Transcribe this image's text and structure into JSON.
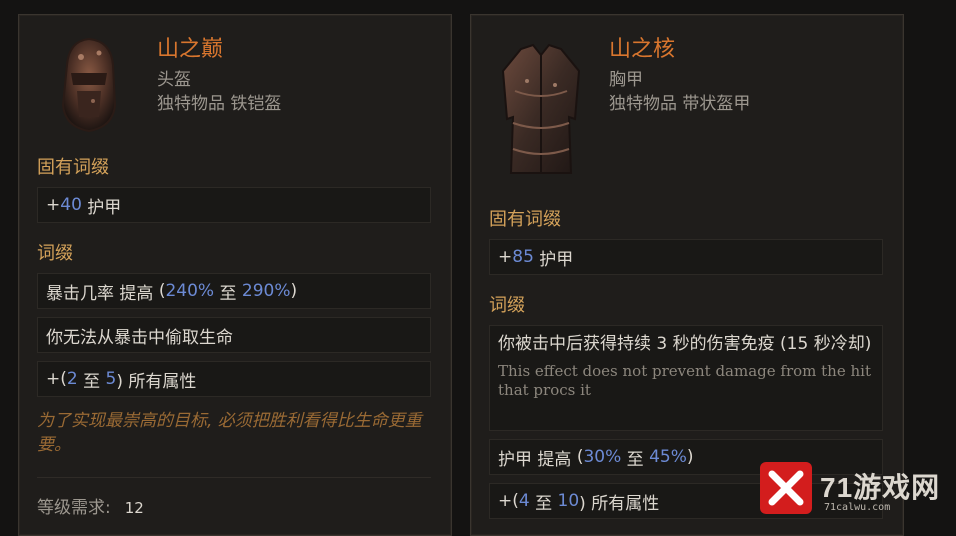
{
  "left_item": {
    "name": "山之巅",
    "type": "头盔",
    "rarity_line": "独特物品 铁铠盔",
    "implicit_header": "固有词缀",
    "implicit": {
      "prefix": "+",
      "value": "40",
      "label": "护甲"
    },
    "affix_header": "词缀",
    "affixes": [
      {
        "text": "暴击几率 提高",
        "open": "(",
        "min": "240%",
        "sep": "至",
        "max": "290%",
        "close": ")"
      },
      {
        "text": "你无法从暴击中偷取生命"
      },
      {
        "prefix": "+(",
        "min": "2",
        "sep": "至",
        "max": "5",
        "suffix": ") 所有属性"
      }
    ],
    "flavor": "为了实现最崇高的目标, 必须把胜利看得比生命更重要。",
    "level_label": "等级需求:",
    "level_value": "12"
  },
  "right_item": {
    "name": "山之核",
    "type": "胸甲",
    "rarity_line": "独特物品 带状盔甲",
    "implicit_header": "固有词缀",
    "implicit": {
      "prefix": "+",
      "value": "85",
      "label": "护甲"
    },
    "affix_header": "词缀",
    "affixes": [
      {
        "text": "你被击中后获得持续 3 秒的伤害免疫 (15 秒冷却)",
        "note": "This effect does not prevent damage from the hit that procs it"
      },
      {
        "text": "护甲 提高",
        "open": "(",
        "min": "30%",
        "sep": "至",
        "max": "45%",
        "close": ")"
      },
      {
        "prefix": "+(",
        "min": "4",
        "sep": "至",
        "max": "10",
        "suffix": ") 所有属性"
      }
    ]
  },
  "watermark": {
    "text": "71游戏网",
    "url": "71calwu.com"
  },
  "colors": {
    "name": "#d9762e",
    "section": "#d4a25a",
    "number": "#6c8ad4",
    "flavor": "#9a6a34"
  }
}
